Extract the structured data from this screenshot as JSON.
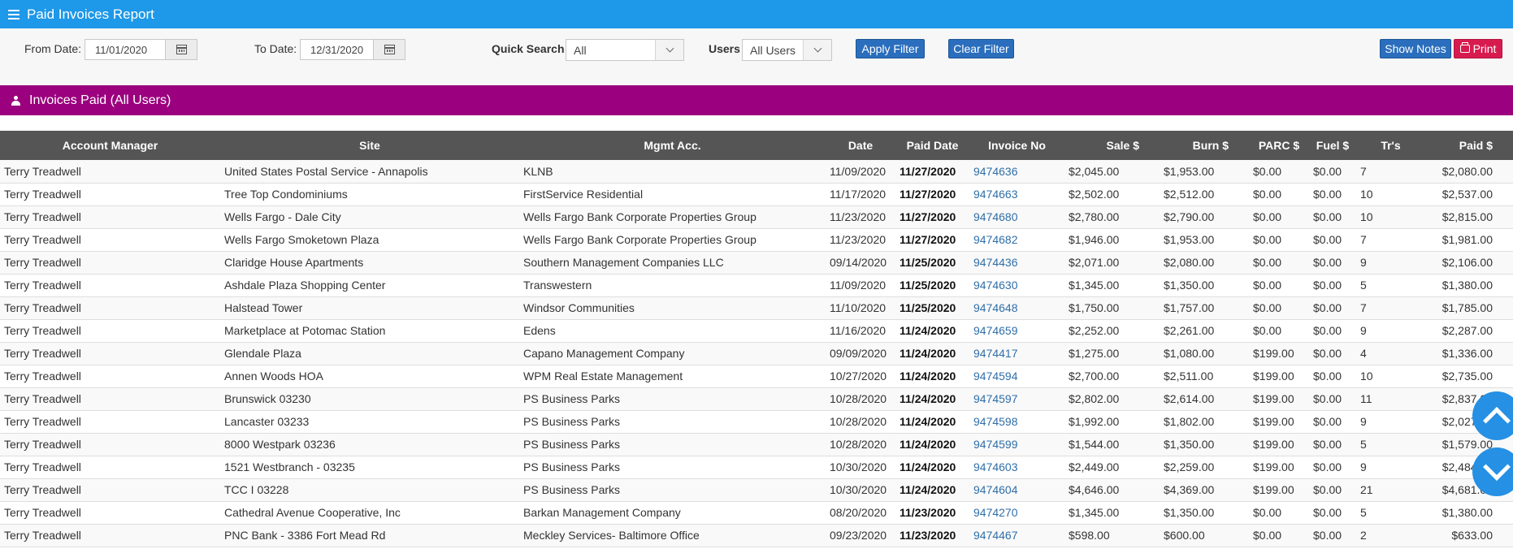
{
  "header": {
    "title": "Paid Invoices Report",
    "menu_icon": "hamburger-menu-icon"
  },
  "filters": {
    "from_label": "From Date:",
    "from_value": "11/01/2020",
    "to_label": "To Date:",
    "to_value": "12/31/2020",
    "quick_search_label": "Quick Search",
    "quick_search_value": "All",
    "users_label": "Users",
    "users_value": "All Users",
    "apply_label": "Apply Filter",
    "clear_label": "Clear Filter",
    "show_notes_label": "Show Notes",
    "print_label": "Print"
  },
  "section": {
    "title": "Invoices Paid (All Users)"
  },
  "table": {
    "columns": [
      "Account Manager",
      "Site",
      "Mgmt Acc.",
      "Date",
      "Paid Date",
      "Invoice No",
      "Sale $",
      "Burn $",
      "PARC $",
      "Fuel $",
      "Tr's",
      "Paid $"
    ],
    "rows": [
      [
        "Terry Treadwell",
        "United States Postal Service - Annapolis",
        "KLNB",
        "11/09/2020",
        "11/27/2020",
        "9474636",
        "$2,045.00",
        "$1,953.00",
        "$0.00",
        "$0.00",
        "7",
        "$2,080.00"
      ],
      [
        "Terry Treadwell",
        "Tree Top Condominiums",
        "FirstService Residential",
        "11/17/2020",
        "11/27/2020",
        "9474663",
        "$2,502.00",
        "$2,512.00",
        "$0.00",
        "$0.00",
        "10",
        "$2,537.00"
      ],
      [
        "Terry Treadwell",
        "Wells Fargo - Dale City",
        "Wells Fargo Bank Corporate Properties Group",
        "11/23/2020",
        "11/27/2020",
        "9474680",
        "$2,780.00",
        "$2,790.00",
        "$0.00",
        "$0.00",
        "10",
        "$2,815.00"
      ],
      [
        "Terry Treadwell",
        "Wells Fargo Smoketown Plaza",
        "Wells Fargo Bank Corporate Properties Group",
        "11/23/2020",
        "11/27/2020",
        "9474682",
        "$1,946.00",
        "$1,953.00",
        "$0.00",
        "$0.00",
        "7",
        "$1,981.00"
      ],
      [
        "Terry Treadwell",
        "Claridge House Apartments",
        "Southern Management Companies LLC",
        "09/14/2020",
        "11/25/2020",
        "9474436",
        "$2,071.00",
        "$2,080.00",
        "$0.00",
        "$0.00",
        "9",
        "$2,106.00"
      ],
      [
        "Terry Treadwell",
        "Ashdale Plaza Shopping Center",
        "Transwestern",
        "11/09/2020",
        "11/25/2020",
        "9474630",
        "$1,345.00",
        "$1,350.00",
        "$0.00",
        "$0.00",
        "5",
        "$1,380.00"
      ],
      [
        "Terry Treadwell",
        "Halstead Tower",
        "Windsor Communities",
        "11/10/2020",
        "11/25/2020",
        "9474648",
        "$1,750.00",
        "$1,757.00",
        "$0.00",
        "$0.00",
        "7",
        "$1,785.00"
      ],
      [
        "Terry Treadwell",
        "Marketplace at Potomac Station",
        "Edens",
        "11/16/2020",
        "11/24/2020",
        "9474659",
        "$2,252.00",
        "$2,261.00",
        "$0.00",
        "$0.00",
        "9",
        "$2,287.00"
      ],
      [
        "Terry Treadwell",
        "Glendale Plaza",
        "Capano Management Company",
        "09/09/2020",
        "11/24/2020",
        "9474417",
        "$1,275.00",
        "$1,080.00",
        "$199.00",
        "$0.00",
        "4",
        "$1,336.00"
      ],
      [
        "Terry Treadwell",
        "Annen Woods HOA",
        "WPM Real Estate Management",
        "10/27/2020",
        "11/24/2020",
        "9474594",
        "$2,700.00",
        "$2,511.00",
        "$199.00",
        "$0.00",
        "10",
        "$2,735.00"
      ],
      [
        "Terry Treadwell",
        "Brunswick 03230",
        "PS Business Parks",
        "10/28/2020",
        "11/24/2020",
        "9474597",
        "$2,802.00",
        "$2,614.00",
        "$199.00",
        "$0.00",
        "11",
        "$2,837.00"
      ],
      [
        "Terry Treadwell",
        "Lancaster 03233",
        "PS Business Parks",
        "10/28/2020",
        "11/24/2020",
        "9474598",
        "$1,992.00",
        "$1,802.00",
        "$199.00",
        "$0.00",
        "9",
        "$2,027.00"
      ],
      [
        "Terry Treadwell",
        "8000 Westpark 03236",
        "PS Business Parks",
        "10/28/2020",
        "11/24/2020",
        "9474599",
        "$1,544.00",
        "$1,350.00",
        "$199.00",
        "$0.00",
        "5",
        "$1,579.00"
      ],
      [
        "Terry Treadwell",
        "1521 Westbranch - 03235",
        "PS Business Parks",
        "10/30/2020",
        "11/24/2020",
        "9474603",
        "$2,449.00",
        "$2,259.00",
        "$199.00",
        "$0.00",
        "9",
        "$2,484.00"
      ],
      [
        "Terry Treadwell",
        "TCC I 03228",
        "PS Business Parks",
        "10/30/2020",
        "11/24/2020",
        "9474604",
        "$4,646.00",
        "$4,369.00",
        "$199.00",
        "$0.00",
        "21",
        "$4,681.00"
      ],
      [
        "Terry Treadwell",
        "Cathedral Avenue Cooperative, Inc",
        "Barkan Management Company",
        "08/20/2020",
        "11/23/2020",
        "9474270",
        "$1,345.00",
        "$1,350.00",
        "$0.00",
        "$0.00",
        "5",
        "$1,380.00"
      ],
      [
        "Terry Treadwell",
        "PNC Bank - 3386 Fort Mead Rd",
        "Meckley Services- Baltimore Office",
        "09/23/2020",
        "11/23/2020",
        "9474467",
        "$598.00",
        "$600.00",
        "$0.00",
        "$0.00",
        "2",
        "$633.00"
      ]
    ]
  },
  "colors": {
    "topbar": "#1e98e8",
    "section": "#9b007e",
    "header_row": "#555555",
    "link": "#2f6ea8",
    "button_blue": "#2a6ebd",
    "button_red": "#d81b4f"
  }
}
